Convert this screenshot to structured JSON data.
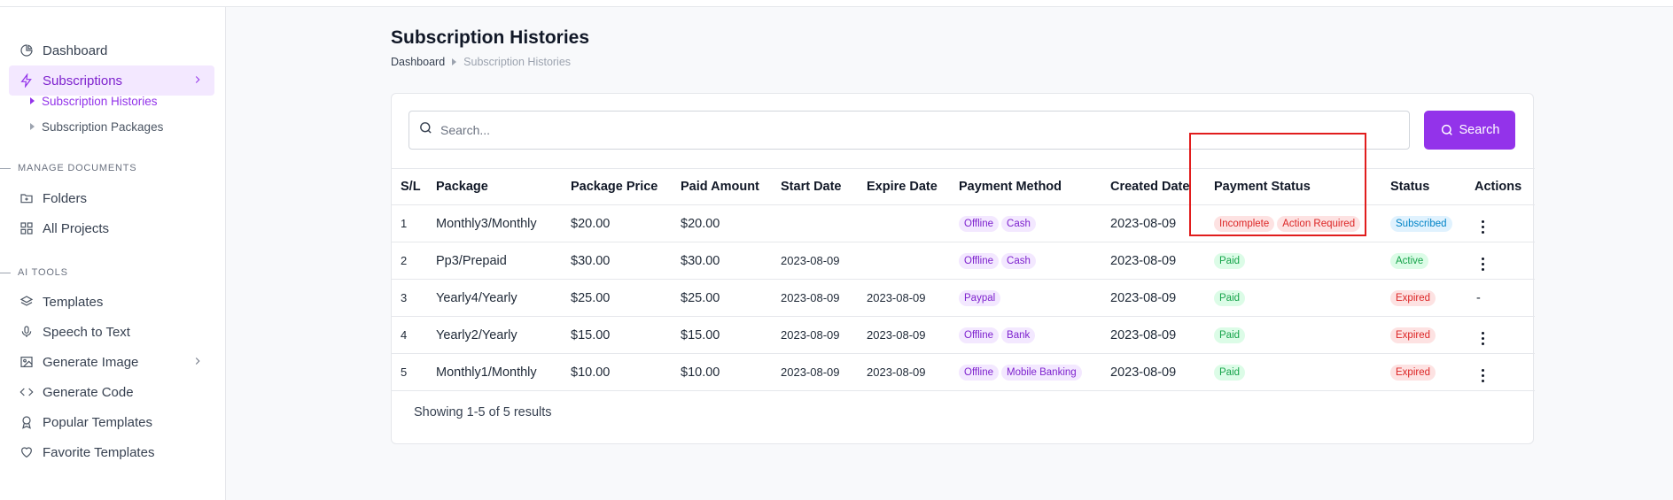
{
  "sidebar": {
    "dashboard": "Dashboard",
    "subscriptions": "Subscriptions",
    "sub_items": [
      "Subscription Histories",
      "Subscription Packages"
    ],
    "section_manage": "MANAGE DOCUMENTS",
    "folders": "Folders",
    "all_projects": "All Projects",
    "section_ai": "AI TOOLS",
    "templates": "Templates",
    "speech_to_text": "Speech to Text",
    "generate_image": "Generate Image",
    "generate_code": "Generate Code",
    "popular_templates": "Popular Templates",
    "favorite_templates": "Favorite Templates"
  },
  "page": {
    "title": "Subscription Histories",
    "breadcrumb_link": "Dashboard",
    "breadcrumb_current": "Subscription Histories"
  },
  "search": {
    "placeholder": "Search...",
    "button_label": "Search"
  },
  "table": {
    "headers": [
      "S/L",
      "Package",
      "Package Price",
      "Paid Amount",
      "Start Date",
      "Expire Date",
      "Payment Method",
      "Created Date",
      "Payment Status",
      "Status",
      "Actions"
    ],
    "rows": [
      {
        "sl": "1",
        "package": "Monthly3/Monthly",
        "price": "$20.00",
        "paid": "$20.00",
        "start": "",
        "expire": "",
        "methods": [
          "Offline",
          "Cash"
        ],
        "created": "2023-08-09",
        "payment_status": [
          "Incomplete",
          "Action Required"
        ],
        "status": "Subscribed",
        "action": "menu"
      },
      {
        "sl": "2",
        "package": "Pp3/Prepaid",
        "price": "$30.00",
        "paid": "$30.00",
        "start": "2023-08-09",
        "expire": "",
        "methods": [
          "Offline",
          "Cash"
        ],
        "created": "2023-08-09",
        "payment_status": [
          "Paid"
        ],
        "status": "Active",
        "action": "menu"
      },
      {
        "sl": "3",
        "package": "Yearly4/Yearly",
        "price": "$25.00",
        "paid": "$25.00",
        "start": "2023-08-09",
        "expire": "2023-08-09",
        "methods": [
          "Paypal"
        ],
        "created": "2023-08-09",
        "payment_status": [
          "Paid"
        ],
        "status": "Expired",
        "action": "-"
      },
      {
        "sl": "4",
        "package": "Yearly2/Yearly",
        "price": "$15.00",
        "paid": "$15.00",
        "start": "2023-08-09",
        "expire": "2023-08-09",
        "methods": [
          "Offline",
          "Bank"
        ],
        "created": "2023-08-09",
        "payment_status": [
          "Paid"
        ],
        "status": "Expired",
        "action": "menu"
      },
      {
        "sl": "5",
        "package": "Monthly1/Monthly",
        "price": "$10.00",
        "paid": "$10.00",
        "start": "2023-08-09",
        "expire": "2023-08-09",
        "methods": [
          "Offline",
          "Mobile Banking"
        ],
        "created": "2023-08-09",
        "payment_status": [
          "Paid"
        ],
        "status": "Expired",
        "action": "menu"
      }
    ]
  },
  "footer": {
    "results_text": "Showing 1-5 of 5 results"
  },
  "colors": {
    "accent": "#9333ea",
    "highlight": "#e11d1d"
  }
}
